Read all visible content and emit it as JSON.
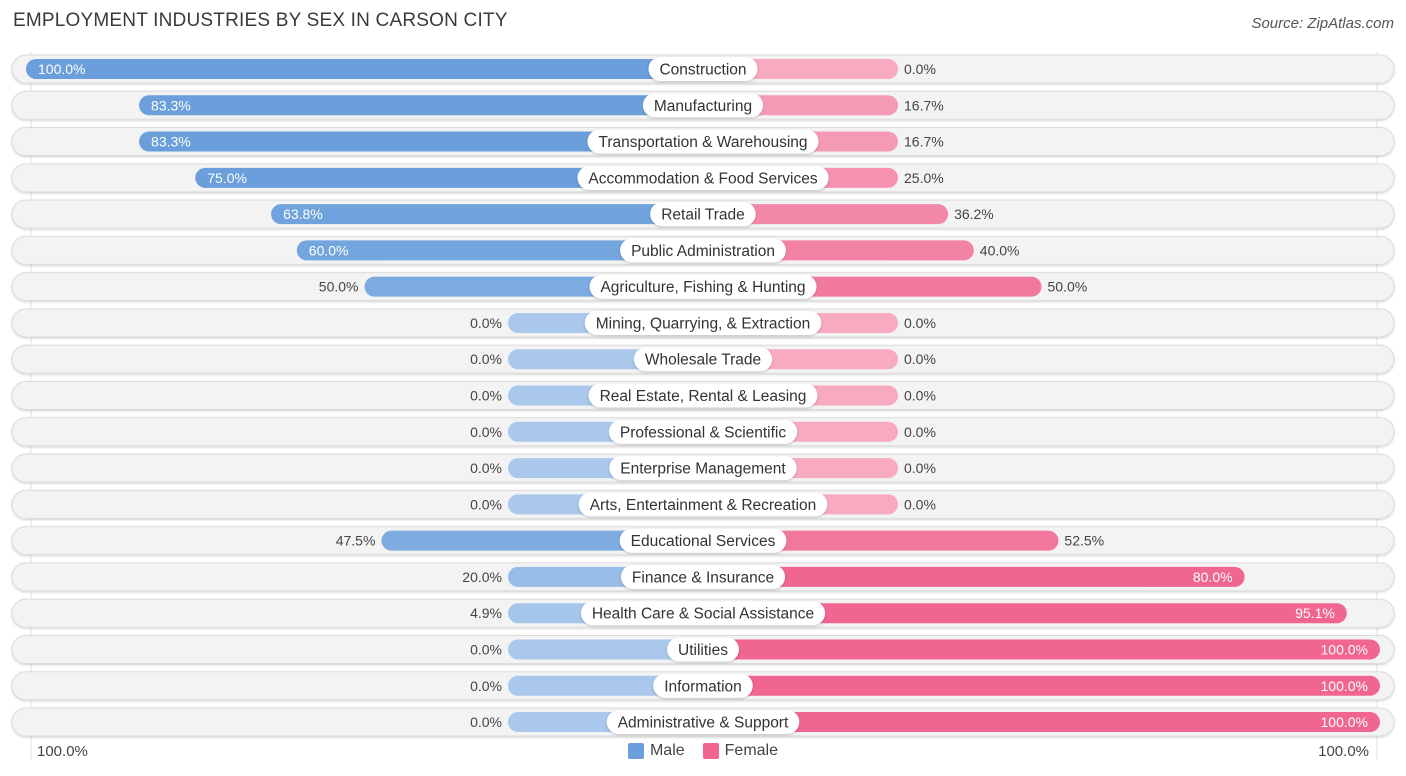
{
  "chart_data": {
    "type": "bar",
    "orientation": "horizontal-diverging",
    "title": "EMPLOYMENT INDUSTRIES BY SEX IN CARSON CITY",
    "source": "Source: ZipAtlas.com",
    "categories": [
      "Construction",
      "Manufacturing",
      "Transportation & Warehousing",
      "Accommodation & Food Services",
      "Retail Trade",
      "Public Administration",
      "Agriculture, Fishing & Hunting",
      "Mining, Quarrying, & Extraction",
      "Wholesale Trade",
      "Real Estate, Rental & Leasing",
      "Professional & Scientific",
      "Enterprise Management",
      "Arts, Entertainment & Recreation",
      "Educational Services",
      "Finance & Insurance",
      "Health Care & Social Assistance",
      "Utilities",
      "Information",
      "Administrative & Support"
    ],
    "series": [
      {
        "name": "Male",
        "color": "#6a9fdc",
        "color_light": "#a9c8ec",
        "values": [
          100.0,
          83.3,
          83.3,
          75.0,
          63.8,
          60.0,
          50.0,
          0.0,
          0.0,
          0.0,
          0.0,
          0.0,
          0.0,
          47.5,
          20.0,
          4.9,
          0.0,
          0.0,
          0.0
        ],
        "labels": [
          "100.0%",
          "83.3%",
          "83.3%",
          "75.0%",
          "63.8%",
          "60.0%",
          "50.0%",
          "0.0%",
          "0.0%",
          "0.0%",
          "0.0%",
          "0.0%",
          "0.0%",
          "47.5%",
          "20.0%",
          "4.9%",
          "0.0%",
          "0.0%",
          "0.0%"
        ]
      },
      {
        "name": "Female",
        "color": "#f06690",
        "color_light": "#f7aac0",
        "values": [
          0.0,
          16.7,
          16.7,
          25.0,
          36.2,
          40.0,
          50.0,
          0.0,
          0.0,
          0.0,
          0.0,
          0.0,
          0.0,
          52.5,
          80.0,
          95.1,
          100.0,
          100.0,
          100.0
        ],
        "labels": [
          "0.0%",
          "16.7%",
          "16.7%",
          "25.0%",
          "36.2%",
          "40.0%",
          "50.0%",
          "0.0%",
          "0.0%",
          "0.0%",
          "0.0%",
          "0.0%",
          "0.0%",
          "52.5%",
          "80.0%",
          "95.1%",
          "100.0%",
          "100.0%",
          "100.0%"
        ]
      }
    ],
    "xlim": [
      -100,
      100
    ],
    "axis_left_label": "100.0%",
    "axis_right_label": "100.0%",
    "legend_position": "bottom-center",
    "grid": false
  },
  "legend": {
    "male_label": "Male",
    "female_label": "Female",
    "male_color": "#6a9fdc",
    "female_color": "#f06690"
  }
}
